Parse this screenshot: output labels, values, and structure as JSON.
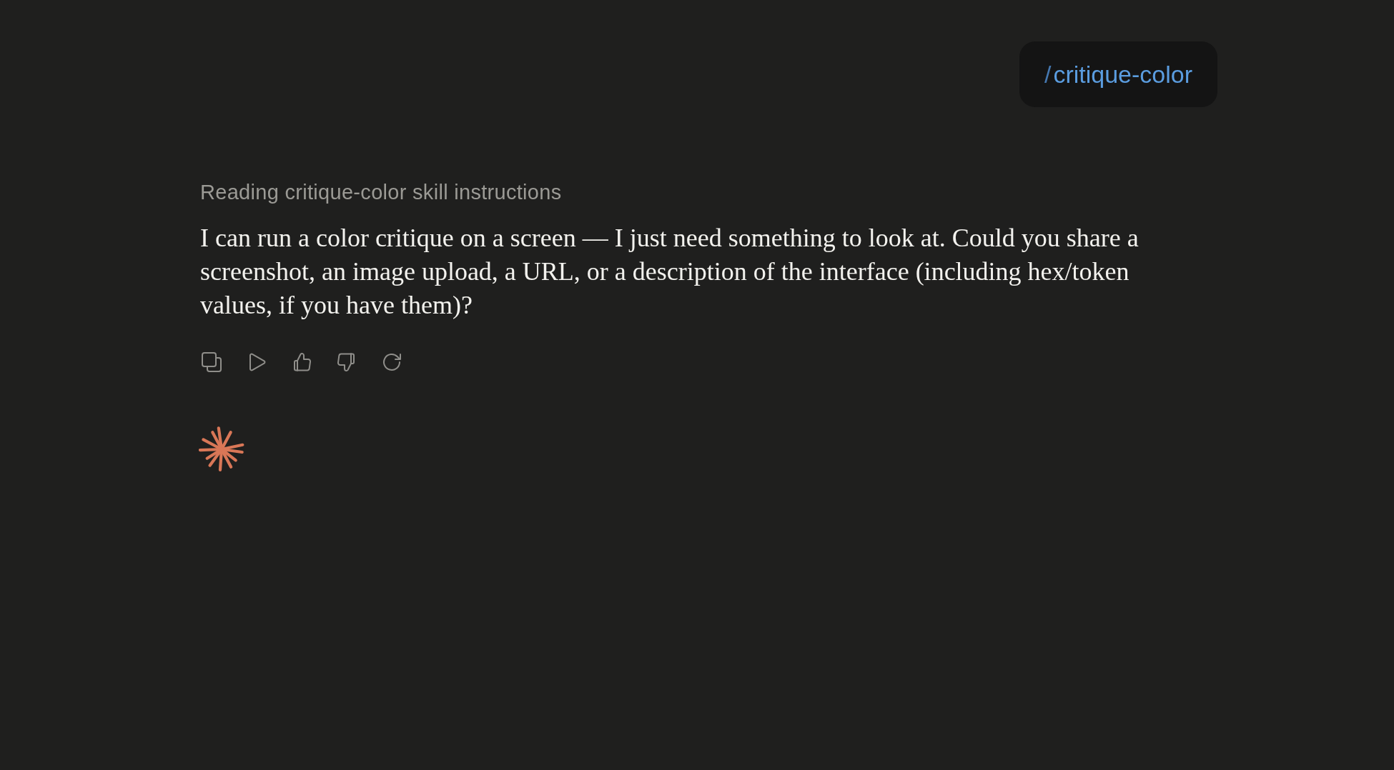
{
  "user_message": {
    "prefix": "/",
    "command": "critique-color"
  },
  "assistant_message": {
    "status": "Reading critique-color skill instructions",
    "text": "I can run a color critique on a screen — I just need something to look at. Could you share a screenshot, an image upload, a URL, or a description of the interface (including hex/token values, if you have them)?"
  }
}
